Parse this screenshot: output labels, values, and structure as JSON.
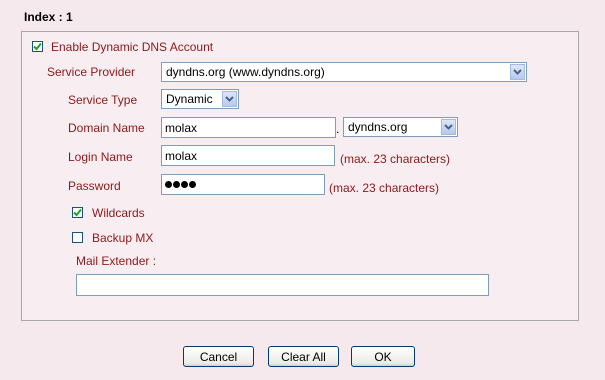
{
  "title": "Index : 1",
  "enable_account": {
    "label": "Enable Dynamic DNS Account",
    "checked": true
  },
  "service_provider": {
    "label": "Service Provider",
    "value": "dyndns.org (www.dyndns.org)"
  },
  "service_type": {
    "label": "Service Type",
    "value": "Dynamic"
  },
  "domain_name": {
    "label": "Domain Name",
    "value": "molax",
    "separator": ".",
    "suffix": "dyndns.org"
  },
  "login_name": {
    "label": "Login Name",
    "value": "molax",
    "hint": "(max. 23 characters)"
  },
  "password": {
    "label": "Password",
    "masked_length": 4,
    "hint": "(max. 23 characters)"
  },
  "wildcards": {
    "label": "Wildcards",
    "checked": true
  },
  "backup_mx": {
    "label": "Backup MX",
    "checked": false
  },
  "mail_extender": {
    "label": "Mail Extender :",
    "value": ""
  },
  "buttons": {
    "cancel": "Cancel",
    "clear_all": "Clear All",
    "ok": "OK"
  }
}
